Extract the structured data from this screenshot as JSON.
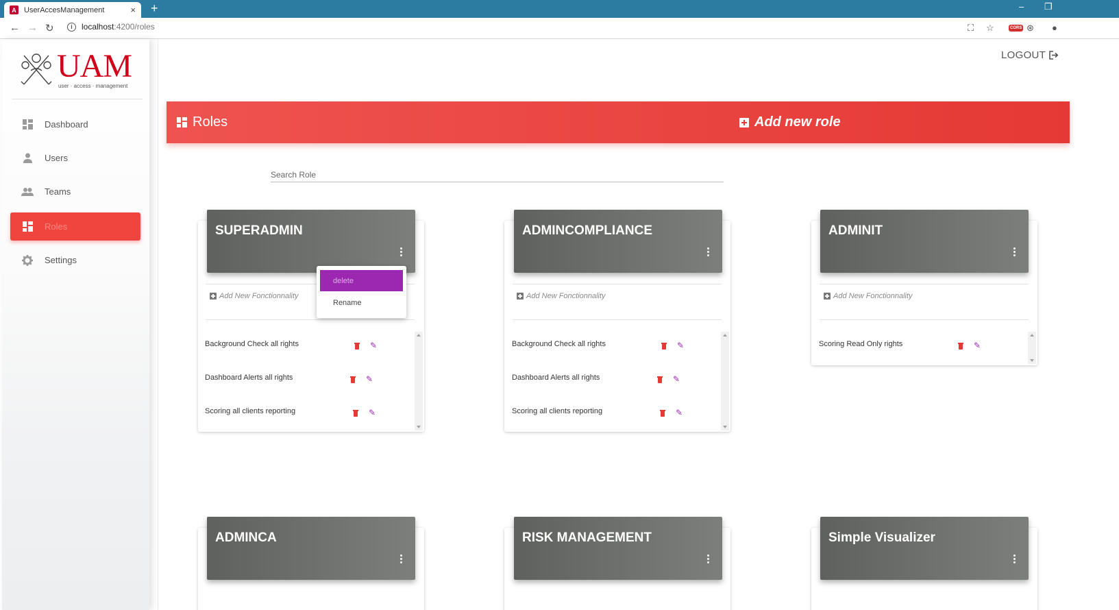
{
  "browser": {
    "tab_title": "UserAccesManagement",
    "tab_close": "×",
    "new_tab": "+",
    "url_host": "localhost",
    "url_path": ":4200/roles",
    "minimize": "–",
    "restore": "❐"
  },
  "sidebar": {
    "logo_text": "UAM",
    "logo_tagline": "user · access · management",
    "items": [
      {
        "label": "Dashboard",
        "icon": "dashboard-icon"
      },
      {
        "label": "Users",
        "icon": "person-icon"
      },
      {
        "label": "Teams",
        "icon": "people-icon"
      },
      {
        "label": "Roles",
        "icon": "dashboard-icon",
        "active": true
      },
      {
        "label": "Settings",
        "icon": "gear-icon"
      }
    ]
  },
  "top": {
    "logout": "LOGOUT"
  },
  "header": {
    "title": "Roles",
    "add_label": "Add new role"
  },
  "search": {
    "placeholder": "Search Role"
  },
  "add_fn_label": "Add New Fonctionnality",
  "context_menu": {
    "delete": "delete",
    "rename": "Rename"
  },
  "roles": [
    {
      "name": "SUPERADMIN",
      "permissions": [
        "Background Check all rights",
        "Dashboard Alerts all rights",
        "Scoring all clients reporting"
      ]
    },
    {
      "name": "ADMINCOMPLIANCE",
      "permissions": [
        "Background Check all rights",
        "Dashboard Alerts all rights",
        "Scoring all clients reporting"
      ]
    },
    {
      "name": "ADMINIT",
      "permissions": [
        "Scoring Read Only rights"
      ]
    },
    {
      "name": "ADMINCA",
      "permissions": []
    },
    {
      "name": "RISK MANAGEMENT",
      "permissions": []
    },
    {
      "name": "Simple Visualizer",
      "permissions": []
    }
  ],
  "colors": {
    "accent": "#e53935",
    "menu_highlight": "#9c27b0",
    "card_header": "#6b6e6a"
  }
}
